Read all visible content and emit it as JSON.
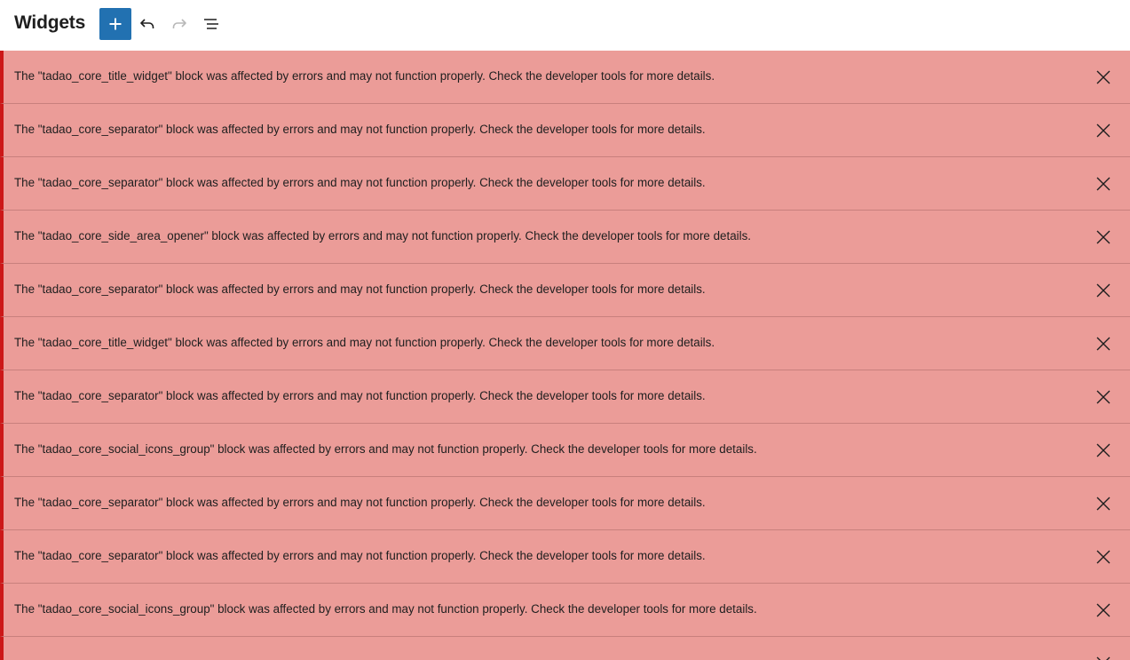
{
  "header": {
    "title": "Widgets",
    "add_label": "Add block",
    "undo_label": "Undo",
    "redo_label": "Redo",
    "list_view_label": "List View"
  },
  "colors": {
    "accent": "#2271b1",
    "notice_bg": "#eb9c98",
    "notice_border": "#cc1818"
  },
  "notices": [
    {
      "text": "The \"tadao_core_title_widget\" block was affected by errors and may not function properly. Check the developer tools for more details.",
      "icon": "close-icon"
    },
    {
      "text": "The \"tadao_core_separator\" block was affected by errors and may not function properly. Check the developer tools for more details.",
      "icon": "close-icon"
    },
    {
      "text": "The \"tadao_core_separator\" block was affected by errors and may not function properly. Check the developer tools for more details.",
      "icon": "close-icon"
    },
    {
      "text": "The \"tadao_core_side_area_opener\" block was affected by errors and may not function properly. Check the developer tools for more details.",
      "icon": "close-icon"
    },
    {
      "text": "The \"tadao_core_separator\" block was affected by errors and may not function properly. Check the developer tools for more details.",
      "icon": "close-icon"
    },
    {
      "text": "The \"tadao_core_title_widget\" block was affected by errors and may not function properly. Check the developer tools for more details.",
      "icon": "close-icon"
    },
    {
      "text": "The \"tadao_core_separator\" block was affected by errors and may not function properly. Check the developer tools for more details.",
      "icon": "close-icon"
    },
    {
      "text": "The \"tadao_core_social_icons_group\" block was affected by errors and may not function properly. Check the developer tools for more details.",
      "icon": "close-icon"
    },
    {
      "text": "The \"tadao_core_separator\" block was affected by errors and may not function properly. Check the developer tools for more details.",
      "icon": "close-icon"
    },
    {
      "text": "The \"tadao_core_separator\" block was affected by errors and may not function properly. Check the developer tools for more details.",
      "icon": "close-icon"
    },
    {
      "text": "The \"tadao_core_social_icons_group\" block was affected by errors and may not function properly. Check the developer tools for more details.",
      "icon": "close-icon"
    },
    {
      "text": "",
      "icon": "close-icon"
    }
  ]
}
